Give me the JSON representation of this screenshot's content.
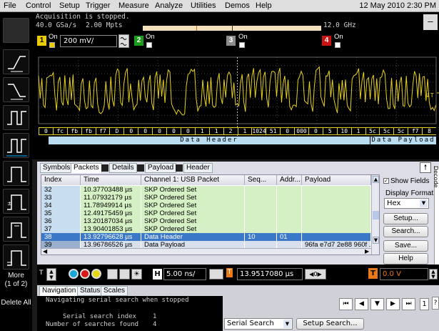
{
  "menu": {
    "items": [
      "File",
      "Control",
      "Setup",
      "Trigger",
      "Measure",
      "Analyze",
      "Utilities",
      "Demos",
      "Help"
    ],
    "datetime": "12 May 2010  2:30 PM"
  },
  "status": {
    "acquisition": "Acquisition is stopped.",
    "sample_rate": "40.0 GSa/s",
    "points": "2.00 Mpts",
    "bandwidth": "12.0 GHz",
    "minimize": "–"
  },
  "channels": [
    {
      "num": "1",
      "on": "On",
      "scale": "200 mV/",
      "color": "#e8cc00"
    },
    {
      "num": "2",
      "on": "On",
      "color": "#1c9a1c"
    },
    {
      "num": "3",
      "on": "On",
      "color": "#8c8c8c"
    },
    {
      "num": "4",
      "on": "On",
      "color": "#c81414"
    }
  ],
  "decode": {
    "bytes": [
      "0",
      "fc",
      "fb",
      "fb",
      "f7",
      "D",
      "0",
      "0",
      "0",
      "0",
      "0",
      "1",
      "1",
      "2",
      "1",
      "1024",
      "51",
      "0",
      "000",
      "0",
      "5",
      "10",
      "1",
      "5c",
      "5c",
      "5c",
      "f7",
      "8"
    ],
    "header_label": "Data Header",
    "payload_label": "Data Payload",
    "marker": "↓T"
  },
  "tabs": [
    "Symbols",
    "Packets",
    "Details",
    "Payload",
    "Header"
  ],
  "table": {
    "headers": [
      "Index",
      "Time",
      "Channel 1: USB Packet",
      "Seq...",
      "Addr...",
      "Payload"
    ],
    "rows": [
      {
        "index": "32",
        "time": "10.37703488 µs",
        "packet": "SKP Ordered Set",
        "seq": "",
        "addr": "",
        "payload": ""
      },
      {
        "index": "33",
        "time": "11.07932179 µs",
        "packet": "SKP Ordered Set",
        "seq": "",
        "addr": "",
        "payload": ""
      },
      {
        "index": "34",
        "time": "11.78949914 µs",
        "packet": "SKP Ordered Set",
        "seq": "",
        "addr": "",
        "payload": ""
      },
      {
        "index": "35",
        "time": "12.49175459 µs",
        "packet": "SKP Ordered Set",
        "seq": "",
        "addr": "",
        "payload": ""
      },
      {
        "index": "36",
        "time": "13.20187034 µs",
        "packet": "SKP Ordered Set",
        "seq": "",
        "addr": "",
        "payload": ""
      },
      {
        "index": "37",
        "time": "13.90401853 µs",
        "packet": "SKP Ordered Set",
        "seq": "",
        "addr": "",
        "payload": ""
      },
      {
        "index": "38",
        "time": "13.92796628 µs",
        "packet": "Data Header",
        "seq": "10",
        "addr": "01",
        "payload": ""
      },
      {
        "index": "39",
        "time": "13.96786526 µs",
        "packet": "Data Payload",
        "seq": "",
        "addr": "",
        "payload": "96fa e7d7 2e88 960f ..."
      }
    ]
  },
  "right_panel": {
    "show_fields": "Show Fields",
    "display_format_label": "Display Format",
    "format_value": "Hex",
    "setup": "Setup...",
    "search": "Search...",
    "save": "Save...",
    "help": "Help",
    "decode_tab": "Decode"
  },
  "controls": {
    "timebase": "5.00 ns/",
    "delay": "13.9517080 µs",
    "trigger_level": "0.0 V",
    "more": "More",
    "more_page": "(1 of 2)",
    "delete_all": "Delete All",
    "trig_letter": "T",
    "h_letter": "H"
  },
  "nav": {
    "tabs": [
      "Navigation",
      "Status",
      "Scales"
    ],
    "message": "Navigating serial search when stopped",
    "search_index_label": "Serial search index",
    "search_index_value": "1",
    "searches_found_label": "Number of searches found",
    "searches_found_value": "4",
    "search_type": "Serial Search",
    "setup_search": "Setup Search...",
    "page_num": "1"
  },
  "colors": {
    "waveform": "#e6d21e",
    "decode_bar": "#b9dcf0",
    "selected_row": "#3c78c8",
    "green_row": "#d5f0c4"
  }
}
